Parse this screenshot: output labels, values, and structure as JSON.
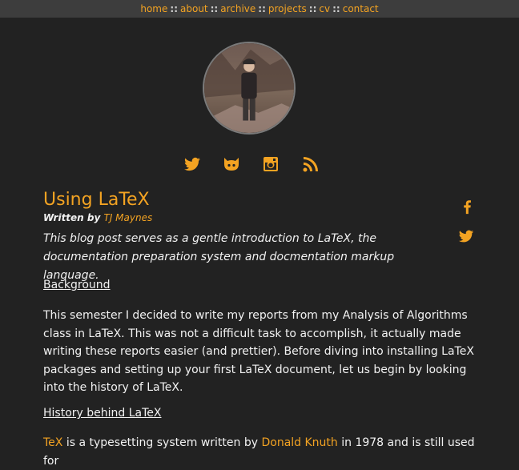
{
  "nav": {
    "items": [
      "home",
      "about",
      "archive",
      "projects",
      "cv",
      "contact"
    ],
    "separator": "::"
  },
  "social_icons": [
    "twitter-icon",
    "github-icon",
    "instagram-icon",
    "rss-icon"
  ],
  "share_icons": [
    "facebook-icon",
    "twitter-icon"
  ],
  "post": {
    "title": "Using LaTeX",
    "byline_prefix": "Written by",
    "author": "TJ Maynes",
    "lead": "This blog post serves as a gentle introduction to LaTeX, the documentation preparation system and docmentation markup language.",
    "section1_heading": "Background",
    "section1_text": "This semester I decided to write my reports from my Analysis of Algorithms class in LaTeX. This was not a difficult task to accomplish, it actually made writing these reports easier (and prettier). Before diving into installing LaTeX packages and setting up your first LaTeX document, let us begin by looking into the history of LaTeX.",
    "section2_heading": "History behind LaTeX",
    "section2_link1": "TeX",
    "section2_text1": " is a typesetting system written by ",
    "section2_link2": "Donald Knuth",
    "section2_text2": " in 1978 and is still used for"
  },
  "colors": {
    "accent": "#f3a322",
    "background": "#222222",
    "nav_background": "#3d3d3d",
    "text": "#f2f2f2"
  }
}
